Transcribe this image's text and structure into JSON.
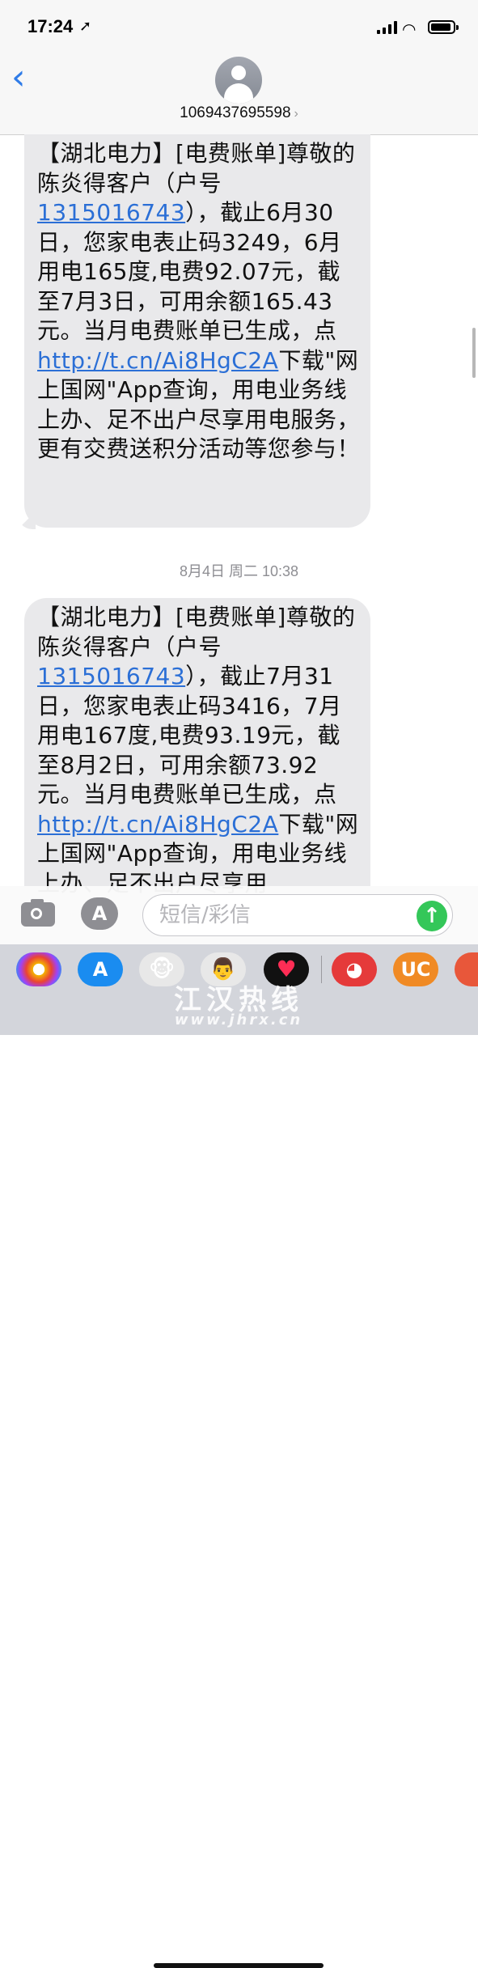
{
  "status": {
    "time": "17:24",
    "location_icon": "location-arrow-icon"
  },
  "header": {
    "contact": "1069437695598",
    "back_icon": "chevron-left-icon"
  },
  "messages": [
    {
      "p1": "【湖北电力】[电费账单]尊敬的陈炎得客户（户号",
      "account": "1315016743",
      "p2": "），截止6月30日，您家电表止码3249，6月用电165度,电费92.07元，截至7月3日，可用余额165.43元。当月电费账单已生成，点",
      "link": "http://t.cn/Ai8HgC2A",
      "p3": "下载\"网上国网\"App查询，用电业务线上办、足不出户尽享用电服务，更有交费送积分活动等您参与！"
    },
    {
      "p1": "【湖北电力】[电费账单]尊敬的陈炎得客户（户号",
      "account": "1315016743",
      "p2": "），截止7月31日，您家电表止码3416，7月用电167度,电费93.19元，截至8月2日，可用余额73.92元。当月电费账单已生成，点",
      "link": "http://t.cn/Ai8HgC2A",
      "p3": "下载\"网上国网\"App查询，用电业务线上办、足不出户尽享用"
    }
  ],
  "timestamp": "8月4日 周二 10:38",
  "input": {
    "placeholder": "短信/彩信"
  },
  "app_drawer": [
    "photos-app-icon",
    "app-store-icon",
    "animoji-monkey-icon",
    "memoji-icon",
    "digital-touch-icon",
    "parrot-app-icon",
    "uc-browser-icon",
    "partial-app-icon"
  ],
  "watermark": {
    "cn": "江汉热线",
    "url": "www.jhrx.cn"
  },
  "colors": {
    "link": "#2b6fd6",
    "bubble": "#e9e9eb",
    "ios_blue": "#2f7ce8",
    "send_green": "#34c759"
  }
}
